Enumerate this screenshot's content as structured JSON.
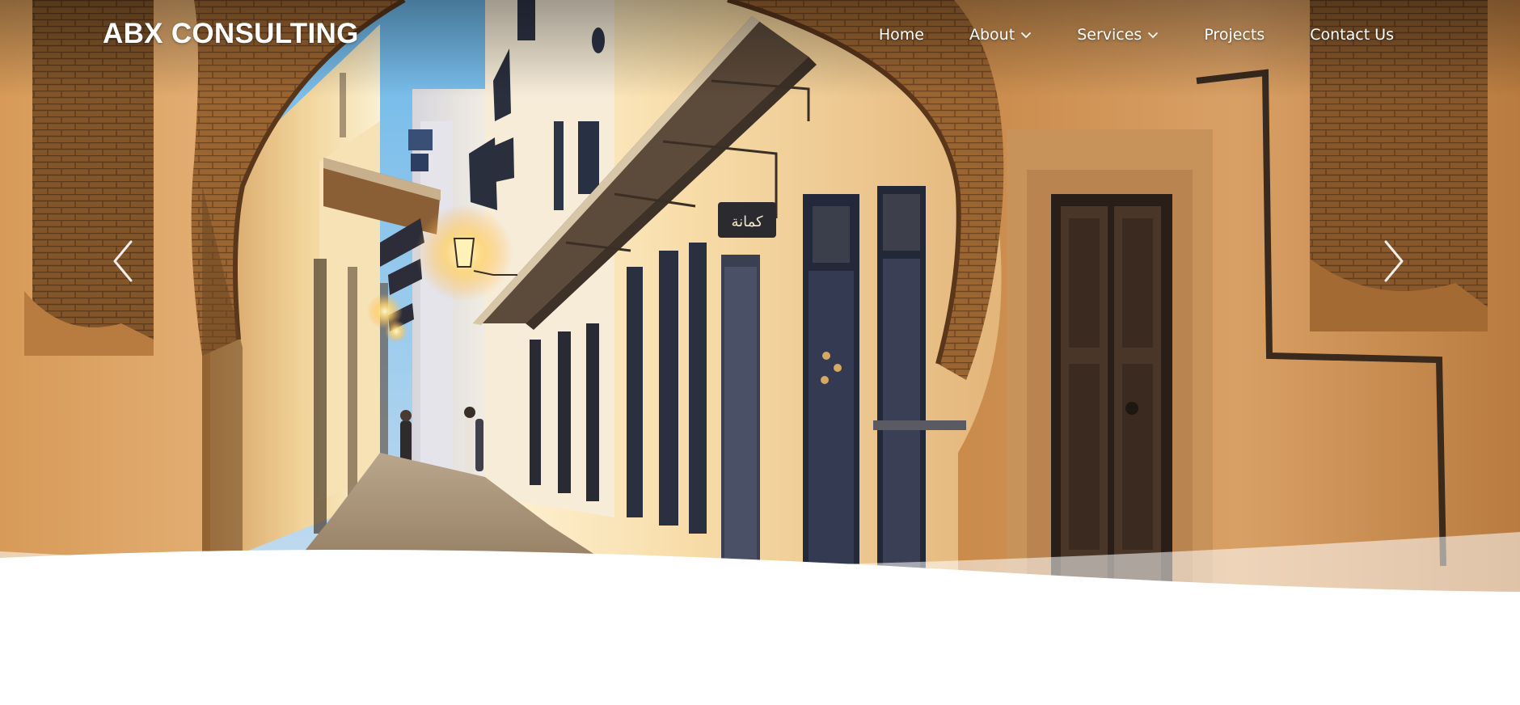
{
  "brand": {
    "name": "ABX CONSULTING"
  },
  "nav": {
    "items": [
      {
        "label": "Home",
        "has_dropdown": false
      },
      {
        "label": "About",
        "has_dropdown": true
      },
      {
        "label": "Services",
        "has_dropdown": true
      },
      {
        "label": "Projects",
        "has_dropdown": false
      },
      {
        "label": "Contact Us",
        "has_dropdown": false
      }
    ]
  },
  "hero": {
    "image_subject": "arched-medina-alley-with-lanterns-and-doors",
    "sign_text": "كمانة",
    "controls": {
      "prev_icon": "chevron-left-icon",
      "next_icon": "chevron-right-icon"
    }
  },
  "colors": {
    "nav_text": "#ffffff",
    "page_background": "#ffffff",
    "sky": "#76c0ea",
    "stone_warm": "#c9894a"
  }
}
